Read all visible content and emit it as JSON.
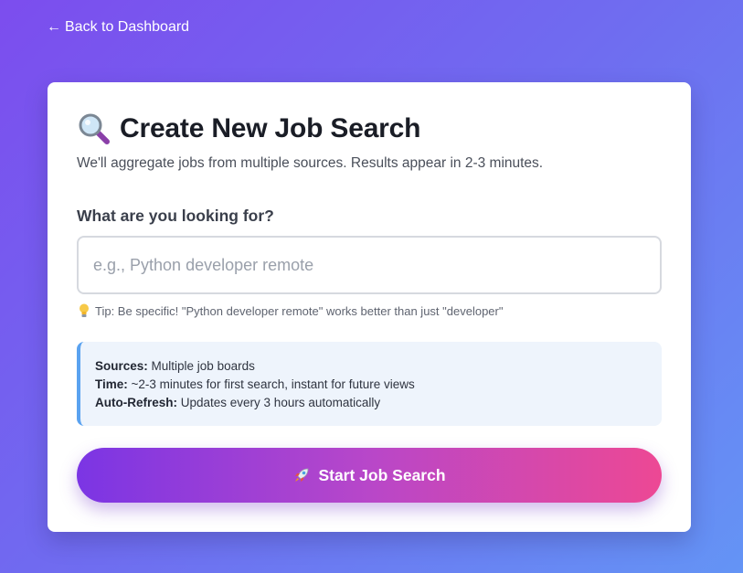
{
  "nav": {
    "back_arrow": "←",
    "back_label": "Back to Dashboard"
  },
  "card": {
    "title_icon": "magnifying-glass-icon",
    "title": "Create New Job Search",
    "subtitle": "We'll aggregate jobs from multiple sources. Results appear in 2-3 minutes."
  },
  "form": {
    "field_label": "What are you looking for?",
    "search_value": "",
    "search_placeholder": "e.g., Python developer remote",
    "tip_icon": "lightbulb-icon",
    "tip_text": "Tip: Be specific! \"Python developer remote\" works better than just \"developer\""
  },
  "info": {
    "sources_label": "Sources:",
    "sources_value": " Multiple job boards",
    "time_label": "Time:",
    "time_value": " ~2-3 minutes for first search, instant for future views",
    "refresh_label": "Auto-Refresh:",
    "refresh_value": " Updates every 3 hours automatically"
  },
  "actions": {
    "start_icon": "rocket-icon",
    "start_label": "Start Job Search"
  },
  "colors": {
    "background_start": "#7c4dee",
    "background_end": "#6494f5",
    "button_start": "#7b35e4",
    "button_end": "#ed4894",
    "info_accent": "#5aa2f0",
    "info_background": "#eef4fc"
  }
}
